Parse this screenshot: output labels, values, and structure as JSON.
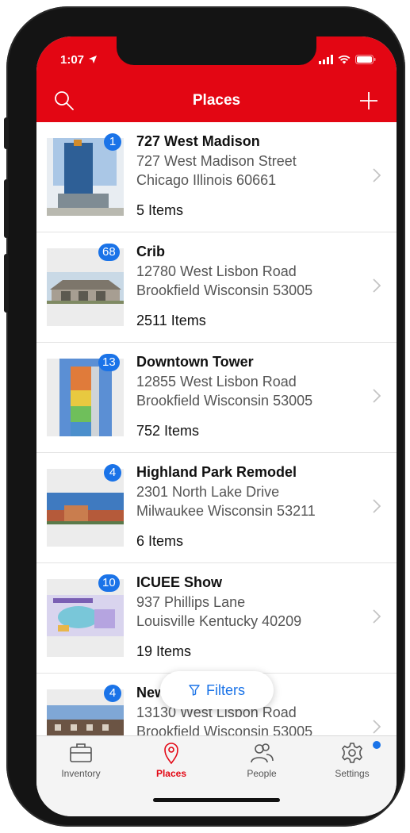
{
  "status": {
    "time": "1:07"
  },
  "header": {
    "title": "Places"
  },
  "places": [
    {
      "name": "727 West Madison",
      "line1": "727 West Madison Street",
      "line2": "Chicago Illinois 60661",
      "count": "5 Items",
      "badge": "1"
    },
    {
      "name": "Crib",
      "line1": "12780 West Lisbon Road",
      "line2": "Brookfield Wisconsin 53005",
      "count": "2511 Items",
      "badge": "68"
    },
    {
      "name": "Downtown Tower",
      "line1": "12855 West Lisbon Road",
      "line2": "Brookfield Wisconsin 53005",
      "count": "752 Items",
      "badge": "13"
    },
    {
      "name": "Highland Park Remodel",
      "line1": "2301 North Lake Drive",
      "line2": "Milwaukee Wisconsin 53211",
      "count": "6 Items",
      "badge": "4"
    },
    {
      "name": "ICUEE Show",
      "line1": "937 Phillips Lane",
      "line2": "Louisville Kentucky 40209",
      "count": "19 Items",
      "badge": "10"
    },
    {
      "name": "New ... Project",
      "line1": "13130 West Lisbon Road",
      "line2": "Brookfield Wisconsin 53005",
      "count": "",
      "badge": "4"
    }
  ],
  "filters": {
    "label": "Filters"
  },
  "tabs": [
    {
      "label": "Inventory",
      "icon": "briefcase-icon"
    },
    {
      "label": "Places",
      "icon": "location-pin-icon",
      "active": true
    },
    {
      "label": "People",
      "icon": "people-icon"
    },
    {
      "label": "Settings",
      "icon": "gear-icon",
      "has_notification": true
    }
  ],
  "colors": {
    "brand_red": "#e30613",
    "accent_blue": "#1a73e8"
  }
}
